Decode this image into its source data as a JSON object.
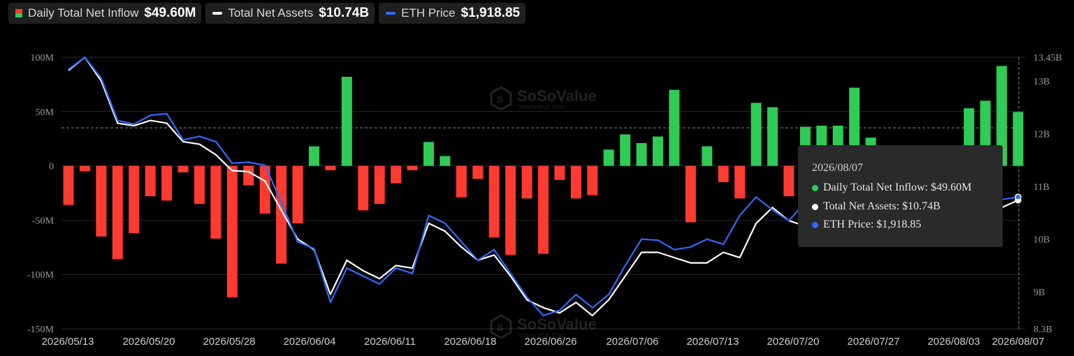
{
  "legend": [
    {
      "label": "Daily Total Net Inflow",
      "value": "$49.60M",
      "swatch": "bar"
    },
    {
      "label": "Total Net Assets",
      "value": "$10.74B",
      "swatch": "line",
      "color": "#ffffff"
    },
    {
      "label": "ETH Price",
      "value": "$1,918.85",
      "swatch": "line",
      "color": "#2f6bff"
    }
  ],
  "watermark": {
    "brand": "SoSoValue",
    "url": "sosovalue.com"
  },
  "tooltip": {
    "date": "2026/08/07",
    "rows": [
      {
        "text": "Daily Total Net Inflow: $49.60M",
        "color": "#2ecc55"
      },
      {
        "text": "Total Net Assets: $10.74B",
        "color": "#ffffff"
      },
      {
        "text": "ETH Price: $1,918.85",
        "color": "#2f6bff"
      }
    ]
  },
  "colors": {
    "positive": "#2ecc55",
    "negative": "#ff3b30",
    "assets": "#ffffff",
    "price": "#2f6bff",
    "grid": "#2a2a2a"
  },
  "chart_data": {
    "type": "bar",
    "x_tick_labels": [
      "2026/05/13",
      "2026/05/20",
      "2026/05/28",
      "2026/06/04",
      "2026/06/11",
      "2026/06/18",
      "2026/06/26",
      "2026/07/06",
      "2026/07/13",
      "2026/07/20",
      "2026/07/27",
      "2026/08/03",
      "2026/08/07"
    ],
    "left_axis": {
      "ticks": [
        "100M",
        "50M",
        "0",
        "-50M",
        "-100M",
        "-150M"
      ],
      "values": [
        100,
        50,
        0,
        -50,
        -100,
        -150
      ],
      "ylim": [
        -150,
        100
      ],
      "unit": "M"
    },
    "right_axis": {
      "ticks": [
        "13.45B",
        "13B",
        "12B",
        "11B",
        "10B",
        "9B",
        "8.3B"
      ],
      "values": [
        13.45,
        13,
        12,
        11,
        10,
        9,
        8.3
      ],
      "ylim": [
        8.3,
        13.45
      ],
      "unit": "B"
    },
    "reference_line": 35,
    "series": [
      {
        "name": "Daily Total Net Inflow",
        "type": "bar",
        "unit": "M",
        "values": [
          -36,
          -5,
          -65,
          -86,
          -62,
          -28,
          -32,
          -6,
          -35,
          -67,
          -121,
          -18,
          -44,
          -90,
          -53,
          18,
          -4,
          82,
          -41,
          -35,
          -16,
          -4,
          22,
          9,
          -29,
          -12,
          -66,
          -82,
          -30,
          -81,
          -13,
          -30,
          -27,
          15,
          29,
          21,
          27,
          70,
          -52,
          18,
          -15,
          -30,
          58,
          54,
          -28,
          36,
          37,
          37,
          72,
          26,
          -10,
          -15,
          -25,
          -30,
          10,
          53,
          60,
          92,
          49.6
        ]
      },
      {
        "name": "Total Net Assets",
        "type": "line",
        "unit": "B",
        "values": [
          13.2,
          13.45,
          13.0,
          12.2,
          12.15,
          12.25,
          12.2,
          11.85,
          11.8,
          11.6,
          11.3,
          11.28,
          11.1,
          10.55,
          10.0,
          9.8,
          8.95,
          9.6,
          9.4,
          9.25,
          9.5,
          9.45,
          10.3,
          10.15,
          9.85,
          9.6,
          9.7,
          9.3,
          8.85,
          8.7,
          8.6,
          8.8,
          8.55,
          8.85,
          9.3,
          9.75,
          9.75,
          9.65,
          9.55,
          9.55,
          9.75,
          9.65,
          10.3,
          10.6,
          10.35,
          10.25,
          10.6,
          10.75,
          10.7,
          10.6,
          10.55,
          10.6,
          10.7,
          10.8,
          10.6,
          10.65,
          10.7,
          10.6,
          10.74
        ]
      },
      {
        "name": "ETH Price",
        "type": "line",
        "unit": "B-axis",
        "values": [
          13.22,
          13.45,
          13.05,
          12.25,
          12.18,
          12.35,
          12.38,
          11.88,
          11.95,
          11.85,
          11.44,
          11.46,
          11.4,
          10.7,
          9.95,
          9.82,
          8.8,
          9.45,
          9.3,
          9.15,
          9.45,
          9.35,
          10.45,
          10.3,
          9.95,
          9.6,
          9.8,
          9.35,
          8.9,
          8.55,
          8.65,
          8.95,
          8.7,
          8.95,
          9.5,
          10.0,
          9.98,
          9.8,
          9.85,
          10.0,
          9.9,
          10.45,
          10.8,
          10.55,
          10.35,
          10.7,
          10.75,
          10.85,
          10.9,
          10.95,
          10.85,
          10.75,
          10.8,
          10.7,
          10.8,
          10.75,
          10.7,
          10.75,
          10.8
        ]
      }
    ]
  }
}
